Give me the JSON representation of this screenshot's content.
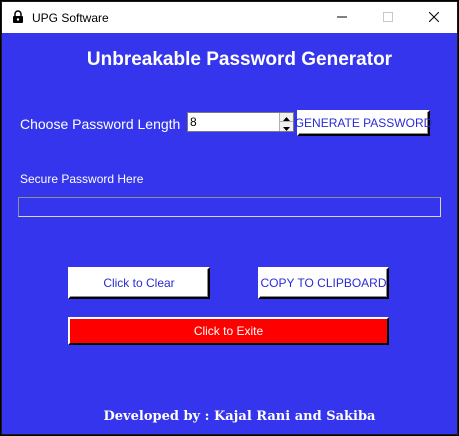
{
  "window": {
    "title": "UPG Software",
    "background_color": "#3535EE",
    "app_icon": "lock-icon",
    "controls": [
      "minimize-icon",
      "maximize-icon",
      "close-icon"
    ]
  },
  "heading": "Unbreakable Password Generator",
  "length": {
    "label": "Choose Password Length",
    "value": "8"
  },
  "buttons": {
    "generate": "GENERATE PASSWORD",
    "clear": "Click to Clear",
    "copy": "COPY TO CLIPBOARD",
    "exit": "Click to Exite"
  },
  "output": {
    "label": "Secure Password Here",
    "value": ""
  },
  "footer": "Developed by : Kajal Rani and Sakiba",
  "colors": {
    "accent_text": "#2a2ad6",
    "exit_button": "#ff0000"
  }
}
